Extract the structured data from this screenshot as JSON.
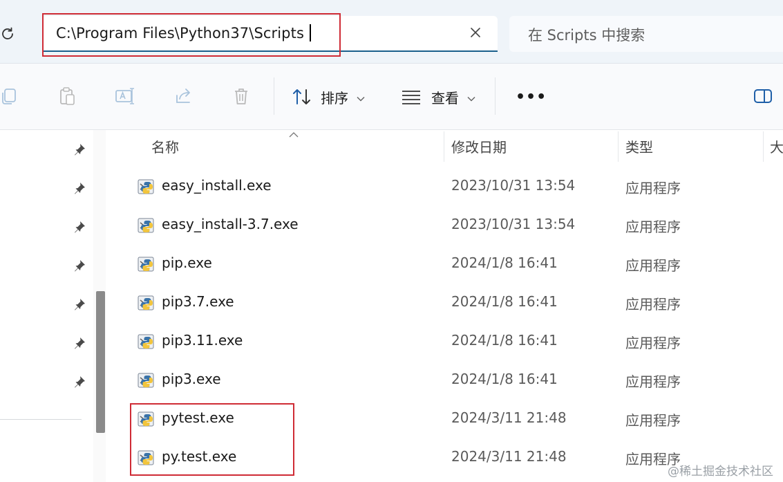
{
  "address_bar": {
    "path": "C:\\Program Files\\Python37\\Scripts"
  },
  "search": {
    "placeholder": "在 Scripts 中搜索"
  },
  "toolbar": {
    "sort_label": "排序",
    "view_label": "查看",
    "more_label": "•••"
  },
  "columns": {
    "name": "名称",
    "modified": "修改日期",
    "type": "类型",
    "size": "大"
  },
  "files": [
    {
      "name": "easy_install.exe",
      "modified": "2023/10/31 13:54",
      "type": "应用程序"
    },
    {
      "name": "easy_install-3.7.exe",
      "modified": "2023/10/31 13:54",
      "type": "应用程序"
    },
    {
      "name": "pip.exe",
      "modified": "2024/1/8 16:41",
      "type": "应用程序"
    },
    {
      "name": "pip3.7.exe",
      "modified": "2024/1/8 16:41",
      "type": "应用程序"
    },
    {
      "name": "pip3.11.exe",
      "modified": "2024/1/8 16:41",
      "type": "应用程序"
    },
    {
      "name": "pip3.exe",
      "modified": "2024/1/8 16:41",
      "type": "应用程序"
    },
    {
      "name": "pytest.exe",
      "modified": "2024/3/11 21:48",
      "type": "应用程序"
    },
    {
      "name": "py.test.exe",
      "modified": "2024/3/11 21:48",
      "type": "应用程序"
    }
  ],
  "watermark": "@稀土掘金技术社区",
  "colors": {
    "highlight": "#cf2b35",
    "address_underline": "#1a5f8c",
    "accent_icon": "#1f5fa8"
  },
  "icons": {
    "refresh": "refresh-icon",
    "clear": "close-icon",
    "copy": "copy-icon",
    "paste": "paste-icon",
    "rename": "rename-icon",
    "share": "share-icon",
    "delete": "delete-icon",
    "sort": "sort-icon",
    "view": "view-icon",
    "details_pane": "details-pane-icon",
    "pin": "pin-icon",
    "file": "python-exe-icon"
  }
}
